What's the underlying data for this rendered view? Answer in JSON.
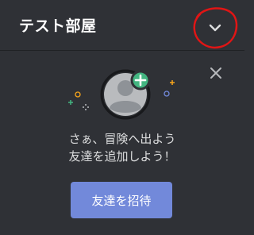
{
  "header": {
    "title": "テスト部屋",
    "dropdown_icon": "chevron-down-icon"
  },
  "panel": {
    "close_icon": "close-icon",
    "illustration_icon": "add-friend-avatar-icon",
    "message_line1": "さぁ、冒険へ出よう",
    "message_line2": "友達を追加しよう！",
    "invite_button_label": "友達を招待"
  },
  "colors": {
    "background": "#2f3136",
    "header_border": "#202225",
    "accent": "#7289da",
    "add_badge": "#43b581",
    "annotation_red": "#e01515"
  }
}
